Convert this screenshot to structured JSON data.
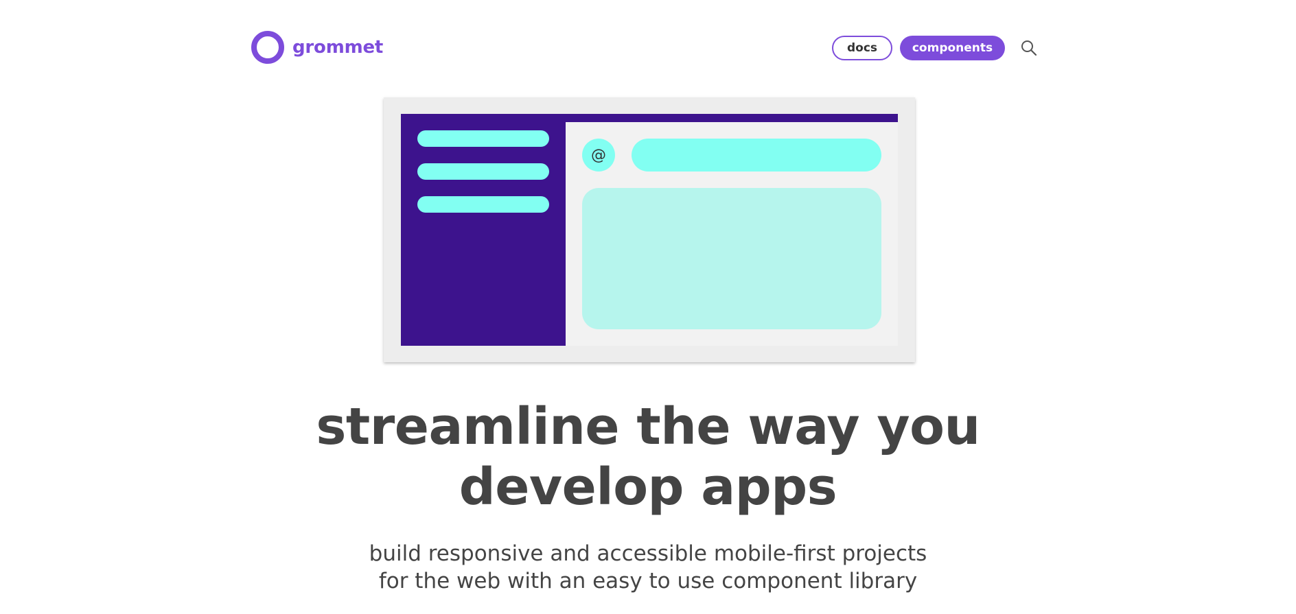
{
  "header": {
    "logo_text": "grommet",
    "nav": {
      "docs_label": "docs",
      "components_label": "components"
    },
    "search_icon": "search-icon"
  },
  "illustration": {
    "avatar_glyph": "@"
  },
  "hero": {
    "title_line1": "streamline the way you",
    "title_line2": "develop apps",
    "subtitle_line1": "build responsive and accessible mobile-first projects",
    "subtitle_line2": "for the web with an easy to use component library"
  },
  "colors": {
    "brand": "#7d4cdb",
    "illustration_dark": "#3d138d",
    "illustration_accent": "#82fff2",
    "illustration_card": "#b6f5ed",
    "text": "#444444"
  }
}
